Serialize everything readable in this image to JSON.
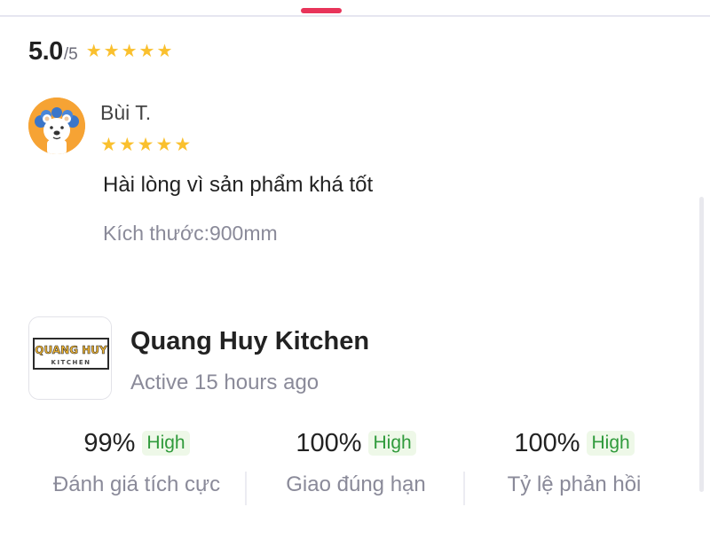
{
  "colors": {
    "handle": "#e8345a",
    "star": "#fac02e",
    "badge_text": "#2f9a3b",
    "badge_bg": "#eef8e8",
    "muted_text": "#8a8a99"
  },
  "rating_summary": {
    "value": "5.0",
    "max": "/5",
    "stars": 5
  },
  "review": {
    "reviewer_name": "Bùi T.",
    "stars": 5,
    "text": "Hài lòng vì sản phẩm khá tốt",
    "variant": "Kích thước:900mm",
    "avatar_icon": "polar-bear-avatar"
  },
  "shop": {
    "logo_line1": "QUANG HUY",
    "logo_line2": "KITCHEN",
    "name": "Quang Huy Kitchen",
    "status": "Active 15 hours ago"
  },
  "stats": [
    {
      "percent": "99%",
      "badge": "High",
      "label": "Đánh giá tích cực"
    },
    {
      "percent": "100%",
      "badge": "High",
      "label": "Giao đúng hạn"
    },
    {
      "percent": "100%",
      "badge": "High",
      "label": "Tỷ lệ phản hồi"
    }
  ]
}
